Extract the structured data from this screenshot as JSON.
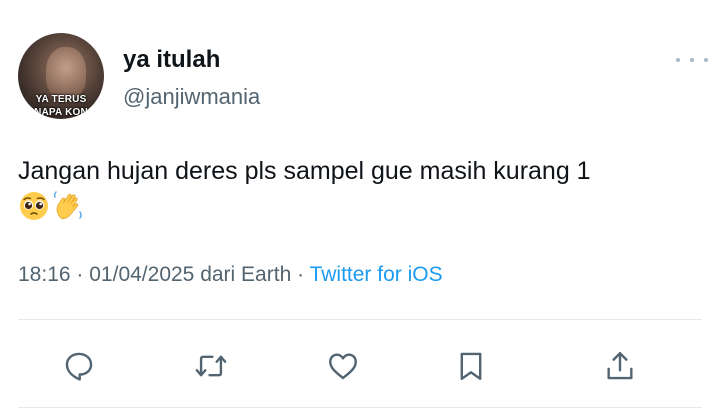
{
  "tweet": {
    "avatar": {
      "caption_line1": "YA TERUS",
      "caption_line2": "NAPA KON"
    },
    "display_name": "ya itulah",
    "handle": "@janjiwmania",
    "more_icon": "more-horizontal-icon",
    "text": "Jangan hujan deres pls sampel gue masih kurang 1",
    "emojis": [
      "pleading-face-emoji",
      "waving-hand-emoji"
    ],
    "time": "18:16",
    "separator": "·",
    "date": "01/04/2025",
    "location": "dari Earth",
    "source": "Twitter for iOS",
    "source_color": "#1d9bf0"
  },
  "actions": [
    {
      "icon": "reply-icon"
    },
    {
      "icon": "retweet-icon"
    },
    {
      "icon": "like-icon"
    },
    {
      "icon": "bookmark-icon"
    },
    {
      "icon": "share-icon"
    }
  ],
  "colors": {
    "text": "#0f1419",
    "secondary": "#536471",
    "divider": "#e7e9ea",
    "action_icon": "#536471"
  }
}
